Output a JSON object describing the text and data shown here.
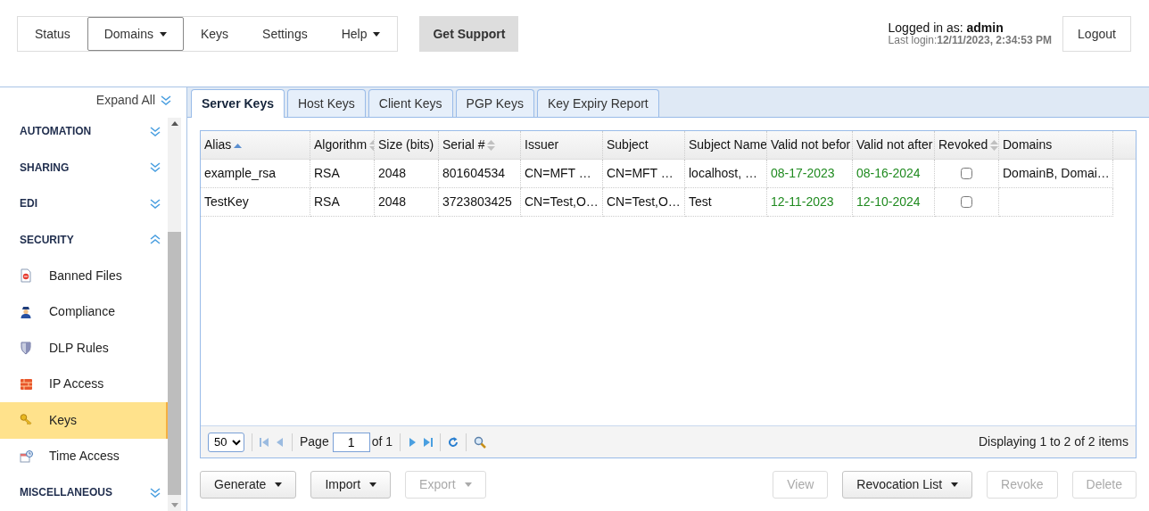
{
  "nav": {
    "items": [
      {
        "label": "Status",
        "selected": false,
        "dropdown": false
      },
      {
        "label": "Domains",
        "selected": true,
        "dropdown": true
      },
      {
        "label": "Keys",
        "selected": false,
        "dropdown": false
      },
      {
        "label": "Settings",
        "selected": false,
        "dropdown": false
      },
      {
        "label": "Help",
        "selected": false,
        "dropdown": true
      }
    ],
    "support_button": "Get Support"
  },
  "user": {
    "prefix": "Logged in as:",
    "name": "admin",
    "last_login_label": "Last login:",
    "last_login": "12/11/2023, 2:34:53 PM",
    "logout": "Logout"
  },
  "sidebar": {
    "expand_all": "Expand All",
    "items": [
      {
        "label": "AUTOMATION",
        "expanded": false
      },
      {
        "label": "SHARING",
        "expanded": false
      },
      {
        "label": "EDI",
        "expanded": false
      },
      {
        "label": "SECURITY",
        "expanded": true,
        "children": [
          {
            "label": "Banned Files",
            "selected": false
          },
          {
            "label": "Compliance",
            "selected": false
          },
          {
            "label": "DLP Rules",
            "selected": false
          },
          {
            "label": "IP Access",
            "selected": false
          },
          {
            "label": "Keys",
            "selected": true
          },
          {
            "label": "Time Access",
            "selected": false
          }
        ]
      },
      {
        "label": "MISCELLANEOUS",
        "expanded": false
      }
    ]
  },
  "tabs": [
    {
      "label": "Server Keys",
      "selected": true
    },
    {
      "label": "Host Keys",
      "selected": false
    },
    {
      "label": "Client Keys",
      "selected": false
    },
    {
      "label": "PGP Keys",
      "selected": false
    },
    {
      "label": "Key Expiry Report",
      "selected": false
    }
  ],
  "table": {
    "columns": [
      {
        "label": "Alias",
        "sortable": true,
        "sorted": true,
        "kind": "text"
      },
      {
        "label": "Algorithm",
        "sortable": true,
        "sorted": false,
        "kind": "text"
      },
      {
        "label": "Size (bits)",
        "kind": "text"
      },
      {
        "label": "Serial #",
        "sortable": true,
        "sorted": false,
        "kind": "text"
      },
      {
        "label": "Issuer",
        "kind": "text"
      },
      {
        "label": "Subject",
        "kind": "text"
      },
      {
        "label": "Subject Name",
        "kind": "text"
      },
      {
        "label": "Valid not befor",
        "kind": "date"
      },
      {
        "label": "Valid not after",
        "kind": "date"
      },
      {
        "label": "Revoked",
        "sortable": true,
        "sorted": false,
        "kind": "check"
      },
      {
        "label": "Domains",
        "kind": "text"
      }
    ],
    "rows": [
      {
        "cells": [
          "example_rsa",
          "RSA",
          "2048",
          "801604534",
          "CN=MFT …",
          "CN=MFT …",
          "localhost, …",
          "08-17-2023",
          "08-16-2024",
          "",
          "DomainB, Domai…"
        ],
        "revoked": false
      },
      {
        "cells": [
          "TestKey",
          "RSA",
          "2048",
          "3723803425",
          "CN=Test,O…",
          "CN=Test,O…",
          "Test",
          "12-11-2023",
          "12-10-2024",
          "",
          ""
        ],
        "revoked": false
      }
    ]
  },
  "pager": {
    "page_size": "50",
    "page_label": "Page",
    "page": "1",
    "of": "of 1",
    "summary": "Displaying 1 to 2 of 2 items"
  },
  "buttons_left": [
    {
      "label": "Generate",
      "dropdown": true,
      "disabled": false
    },
    {
      "label": "Import",
      "dropdown": true,
      "disabled": false
    },
    {
      "label": "Export",
      "dropdown": true,
      "disabled": true
    }
  ],
  "buttons_right": [
    {
      "label": "View",
      "dropdown": false,
      "disabled": true
    },
    {
      "label": "Revocation List",
      "dropdown": true,
      "disabled": false
    },
    {
      "label": "Revoke",
      "dropdown": false,
      "disabled": true
    },
    {
      "label": "Delete",
      "dropdown": false,
      "disabled": true
    }
  ]
}
